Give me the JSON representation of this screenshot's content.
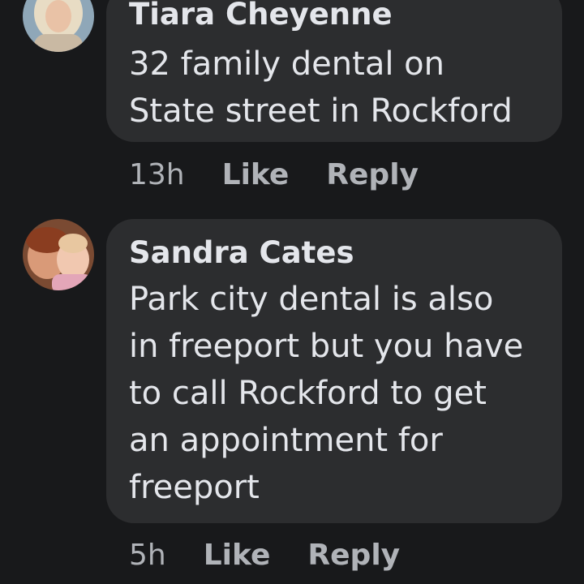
{
  "comments": [
    {
      "author": "Tiara Cheyenne",
      "text": "32 family dental on\nState street in Rockford",
      "time": "13h",
      "like_label": "Like",
      "reply_label": "Reply"
    },
    {
      "author": "Sandra Cates",
      "text": "Park city dental is also\nin freeport  but you have\nto call Rockford to get\nan appointment for\nfreeport",
      "time": "5h",
      "like_label": "Like",
      "reply_label": "Reply"
    }
  ],
  "colors": {
    "background": "#18191b",
    "bubble": "#2c2d2f",
    "primary_text": "#e4e6eb",
    "secondary_text": "#b0b3b8"
  }
}
